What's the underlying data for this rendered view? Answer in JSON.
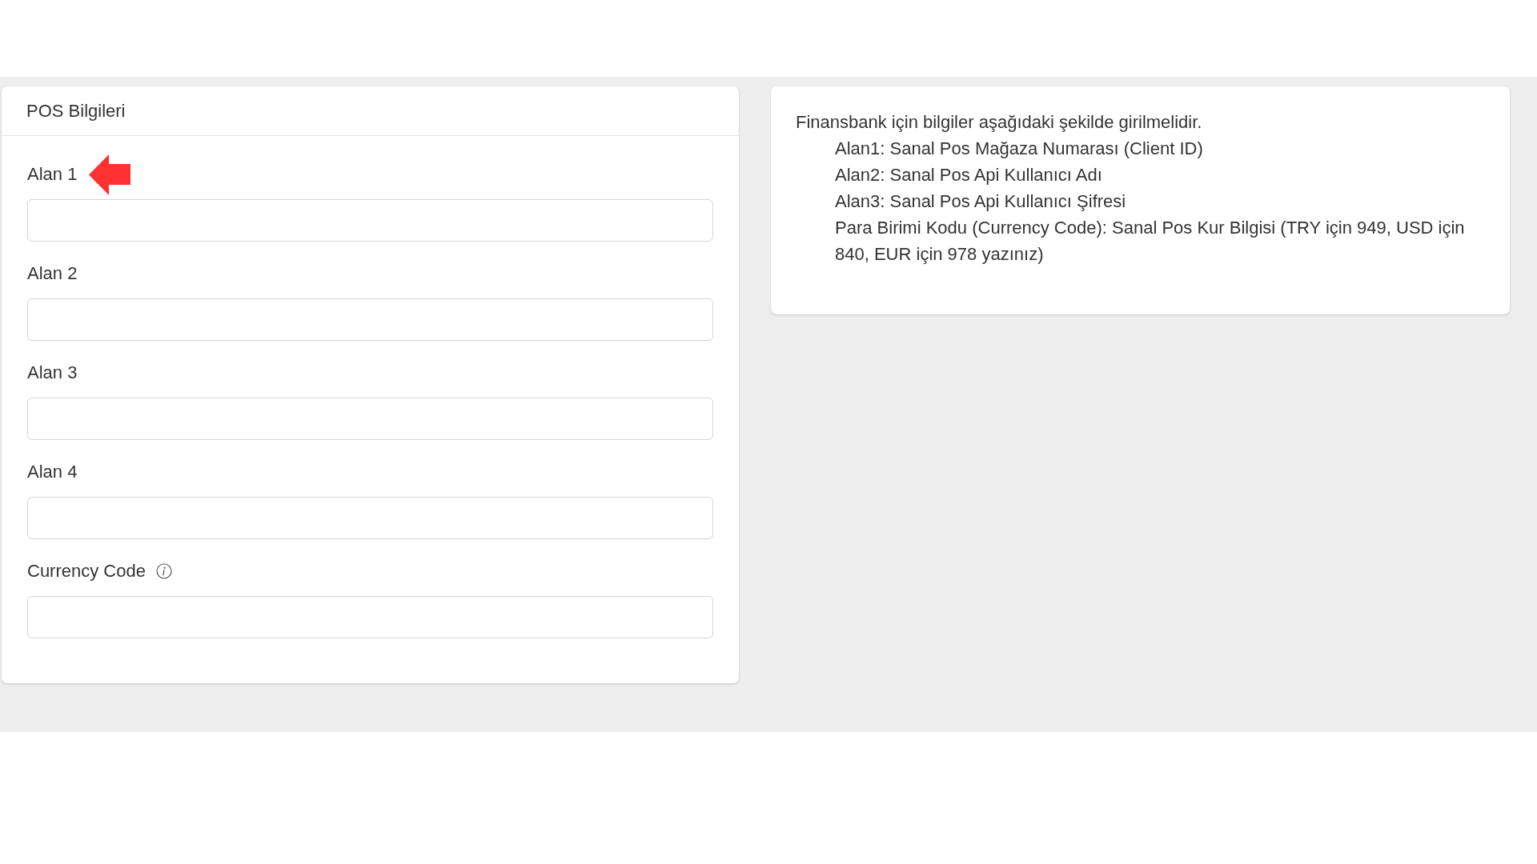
{
  "form_panel": {
    "title": "POS Bilgileri",
    "fields": [
      {
        "label": "Alan 1",
        "marked": true,
        "info": false
      },
      {
        "label": "Alan 2",
        "marked": false,
        "info": false
      },
      {
        "label": "Alan 3",
        "marked": false,
        "info": false
      },
      {
        "label": "Alan 4",
        "marked": false,
        "info": false
      },
      {
        "label": "Currency Code",
        "marked": false,
        "info": true
      }
    ]
  },
  "info_panel": {
    "intro": "Finansbank için bilgiler aşağıdaki şekilde girilmelidir.",
    "lines": [
      "Alan1: Sanal Pos Mağaza Numarası (Client ID)",
      "Alan2: Sanal Pos Api Kullanıcı Adı",
      "Alan3: Sanal Pos Api Kullanıcı Şifresi",
      "Para Birimi Kodu (Currency Code): Sanal Pos Kur Bilgisi (TRY için 949, USD için 840, EUR için 978 yazınız)"
    ]
  }
}
